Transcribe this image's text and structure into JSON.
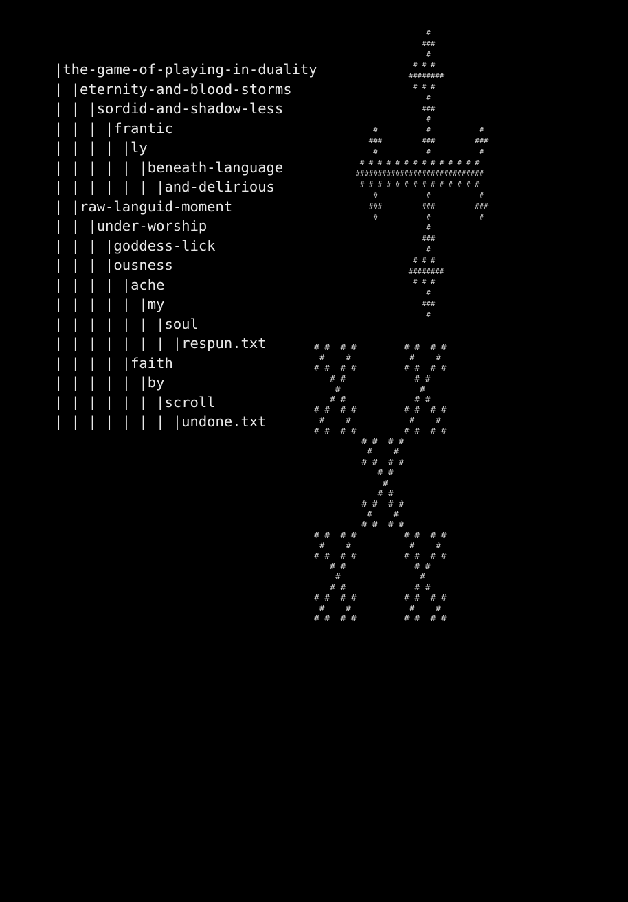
{
  "tree": [
    "|the-game-of-playing-in-duality",
    "| |eternity-and-blood-storms",
    "| | |sordid-and-shadow-less",
    "| | | |frantic",
    "| | | | |ly",
    "| | | | | |beneath-language",
    "| | | | | | |and-delirious",
    "| |raw-languid-moment",
    "| | |under-worship",
    "| | | |goddess-lick",
    "| | | |ousness",
    "| | | | |ache",
    "| | | | | |my",
    "| | | | | | |soul",
    "| | | | | | | |respun.txt",
    "| | | | |faith",
    "| | | | | |by",
    "| | | | | | |scroll",
    "| | | | | | | |undone.txt"
  ],
  "art_cross": [
    "                 #",
    "                ###",
    "                 #",
    "              # # #",
    "             ########",
    "              # # #",
    "                 #",
    "                ###",
    "                 #",
    "     #           #           #",
    "    ###         ###         ###",
    "     #           #           #",
    "  # # # # # # # # # # # # # #",
    " #############################",
    "  # # # # # # # # # # # # # #",
    "     #           #           #",
    "    ###         ###         ###",
    "     #           #           #",
    "                 #",
    "                ###",
    "                 #",
    "              # # #",
    "             ########",
    "              # # #",
    "                 #",
    "                ###",
    "                 #"
  ],
  "art_lattice": [
    "# #  # #         # #  # #",
    " #    #           #    #",
    "# #  # #         # #  # #",
    "   # #             # #",
    "    #               #",
    "   # #             # #",
    "# #  # #         # #  # #",
    " #    #           #    #",
    "# #  # #         # #  # #",
    "         # #  # #",
    "          #    #",
    "         # #  # #",
    "            # #",
    "             #",
    "            # #",
    "         # #  # #",
    "          #    #",
    "         # #  # #",
    "# #  # #         # #  # #",
    " #    #           #    #",
    "# #  # #         # #  # #",
    "   # #             # #",
    "    #               #",
    "   # #             # #",
    "# #  # #         # #  # #",
    " #    #           #    #",
    "# #  # #         # #  # #"
  ]
}
